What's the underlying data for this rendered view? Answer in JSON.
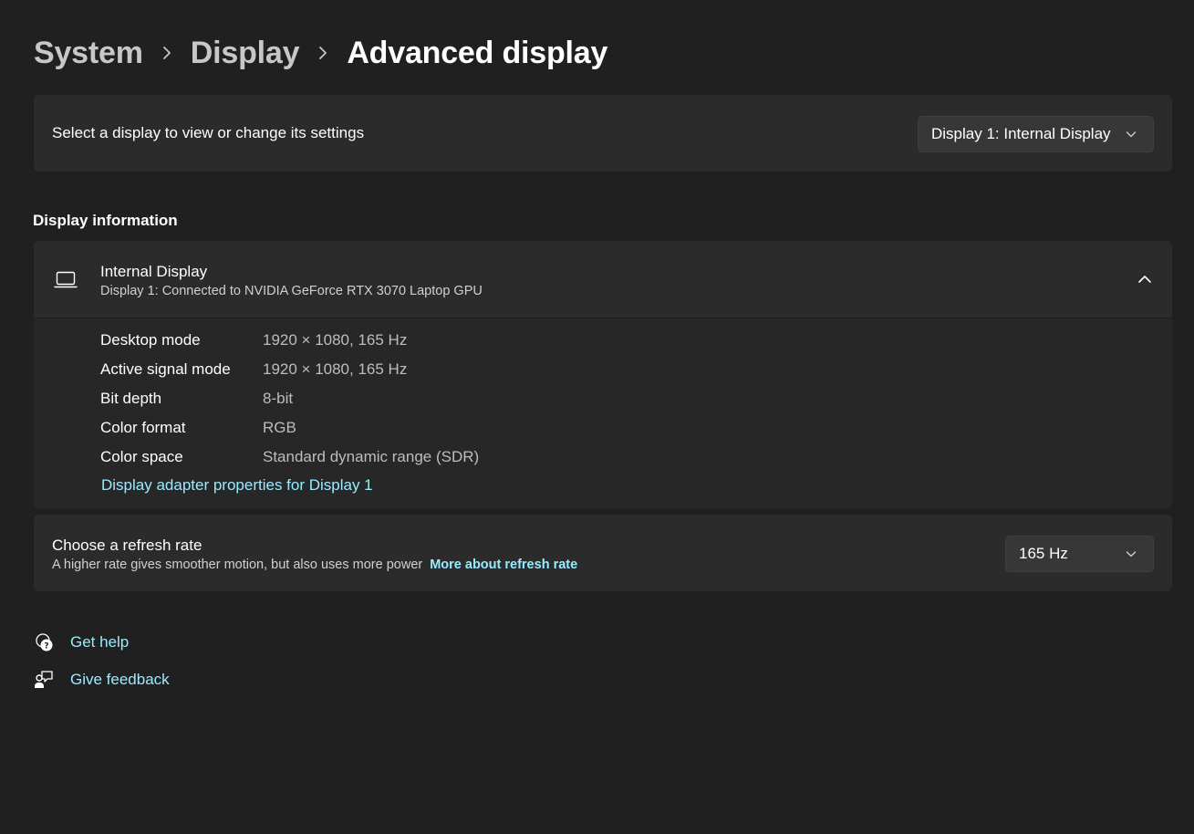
{
  "breadcrumb": {
    "items": [
      "System",
      "Display"
    ],
    "current": "Advanced display"
  },
  "display_select": {
    "label": "Select a display to view or change its settings",
    "selected": "Display 1: Internal Display"
  },
  "display_information": {
    "section_title": "Display information",
    "name": "Internal Display",
    "subtitle": "Display 1: Connected to NVIDIA GeForce RTX 3070 Laptop GPU",
    "rows": [
      {
        "key": "Desktop mode",
        "value": "1920 × 1080, 165 Hz"
      },
      {
        "key": "Active signal mode",
        "value": "1920 × 1080, 165 Hz"
      },
      {
        "key": "Bit depth",
        "value": "8-bit"
      },
      {
        "key": "Color format",
        "value": "RGB"
      },
      {
        "key": "Color space",
        "value": "Standard dynamic range (SDR)"
      }
    ],
    "adapter_link": "Display adapter properties for Display 1"
  },
  "refresh_rate": {
    "title": "Choose a refresh rate",
    "description": "A higher rate gives smoother motion, but also uses more power",
    "link": "More about refresh rate",
    "selected": "165 Hz"
  },
  "footer": {
    "get_help": "Get help",
    "give_feedback": "Give feedback"
  },
  "icons": {
    "breadcrumb_separator": "chevron-right-icon",
    "dropdown": "chevron-down-icon",
    "expander": "chevron-up-icon",
    "display": "laptop-icon",
    "help": "help-chat-icon",
    "feedback": "feedback-icon"
  },
  "colors": {
    "background": "#202020",
    "card": "#2b2b2b",
    "card_expanded": "#272727",
    "accent_link": "#99ebff"
  }
}
